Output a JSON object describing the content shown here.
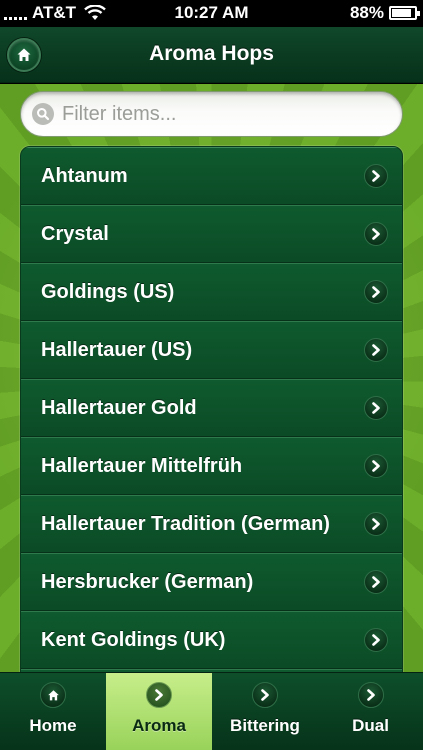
{
  "status_bar": {
    "carrier": "AT&T",
    "time": "10:27 AM",
    "battery": "88%",
    "battery_level": 0.88
  },
  "nav": {
    "title": "Aroma Hops",
    "home_icon": "home-icon"
  },
  "search": {
    "placeholder": "Filter items..."
  },
  "list": {
    "items": [
      {
        "label": "Ahtanum"
      },
      {
        "label": "Crystal"
      },
      {
        "label": "Goldings (US)"
      },
      {
        "label": "Hallertauer (US)"
      },
      {
        "label": "Hallertauer Gold"
      },
      {
        "label": "Hallertauer Mittelfrüh"
      },
      {
        "label": "Hallertauer Tradition (German)"
      },
      {
        "label": "Hersbrucker (German)"
      },
      {
        "label": "Kent Goldings (UK)"
      },
      {
        "label": ""
      }
    ]
  },
  "tabs": [
    {
      "label": "Home",
      "icon": "home-icon",
      "active": false
    },
    {
      "label": "Aroma",
      "icon": "chevron-right-icon",
      "active": true
    },
    {
      "label": "Bittering",
      "icon": "chevron-right-icon",
      "active": false
    },
    {
      "label": "Dual",
      "icon": "chevron-right-icon",
      "active": false
    }
  ],
  "colors": {
    "nav_green": "#0a3a20",
    "list_green": "#0b4b26",
    "sunburst_green": "#6cad2a",
    "active_tab": "#b3e272"
  }
}
